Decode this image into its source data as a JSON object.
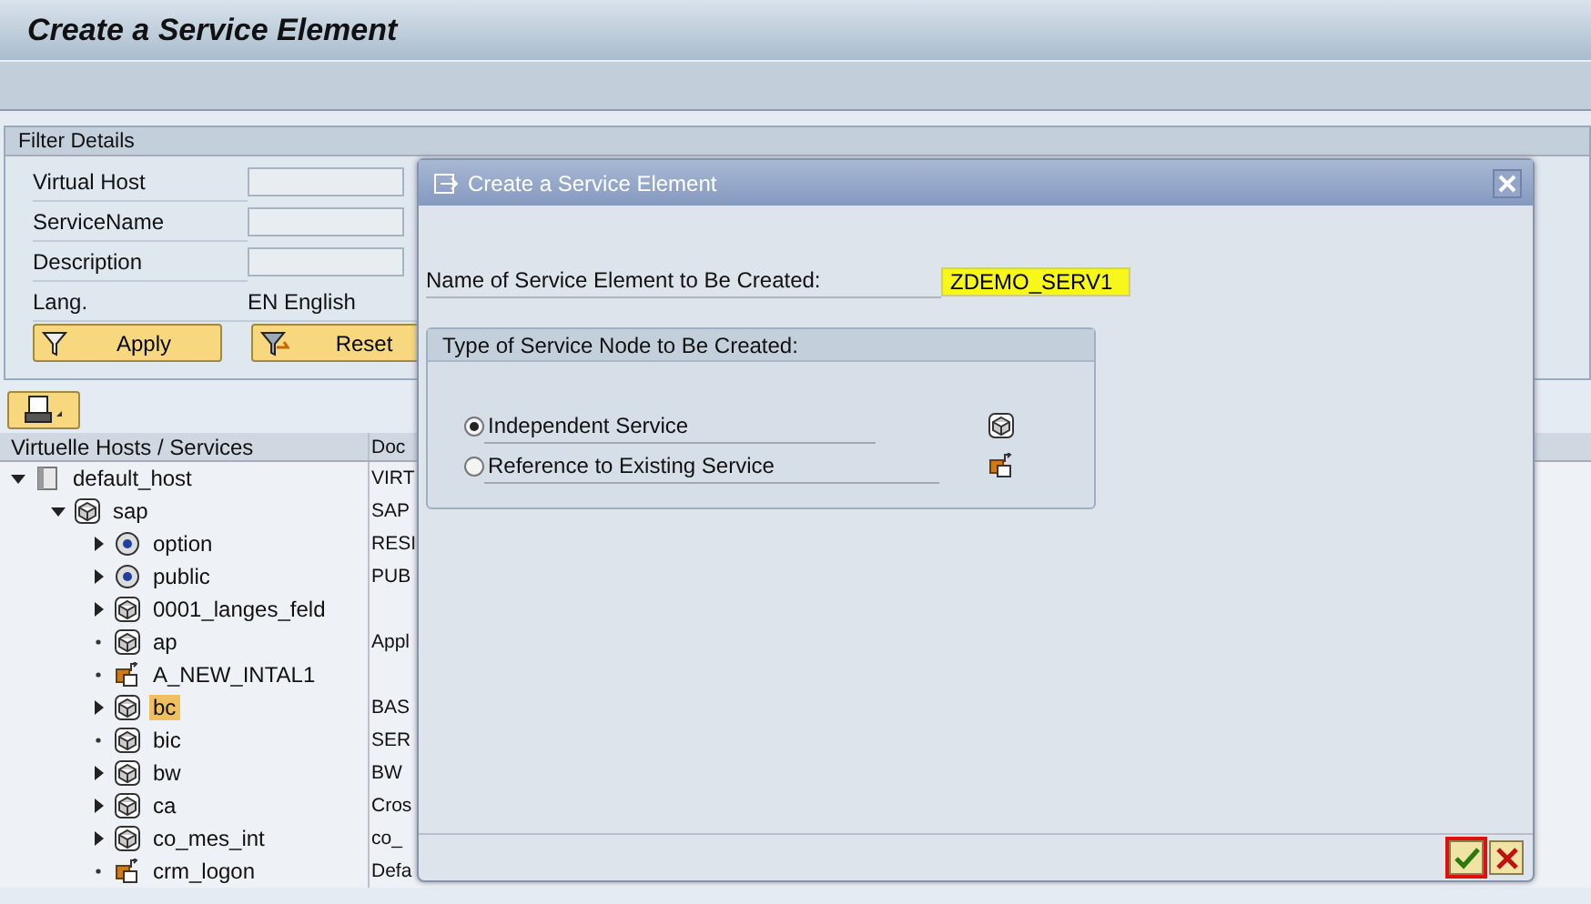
{
  "window": {
    "title": "Create a Service Element"
  },
  "filter": {
    "title": "Filter Details",
    "fields": [
      {
        "label": "Virtual Host"
      },
      {
        "label": "ServiceName"
      },
      {
        "label": "Description"
      },
      {
        "label": "Lang.",
        "value": "EN English"
      }
    ],
    "buttons": [
      "Apply",
      "Reset"
    ]
  },
  "tree": {
    "columns": [
      "Virtuelle Hosts / Services",
      "Doc"
    ],
    "nodes": [
      {
        "name": "default_host",
        "doc": "VIRT",
        "kind": "host",
        "has_children": true,
        "expanded": true,
        "selected": false,
        "children": [
          {
            "name": "sap",
            "doc": "SAP",
            "kind": "service",
            "has_children": true,
            "expanded": true,
            "selected": false,
            "children": [
              {
                "name": "option",
                "doc": "RESI",
                "kind": "node",
                "has_children": true,
                "expanded": false,
                "selected": false
              },
              {
                "name": "public",
                "doc": "PUB",
                "kind": "node",
                "has_children": true,
                "expanded": false,
                "selected": false
              },
              {
                "name": "0001_langes_feld",
                "kind": "service",
                "has_children": true,
                "expanded": false,
                "selected": false
              },
              {
                "name": "ap",
                "doc": "Appl",
                "kind": "service",
                "has_children": false,
                "selected": false
              },
              {
                "name": "A_NEW_INTAL1",
                "kind": "reference",
                "has_children": false,
                "selected": false
              },
              {
                "name": "bc",
                "doc": "BAS",
                "kind": "service",
                "has_children": true,
                "expanded": false,
                "selected": true
              },
              {
                "name": "bic",
                "doc": "SER",
                "kind": "service",
                "has_children": false,
                "selected": false
              },
              {
                "name": "bw",
                "doc": "BW",
                "kind": "service",
                "has_children": true,
                "expanded": false,
                "selected": false
              },
              {
                "name": "ca",
                "doc": "Cros",
                "kind": "service",
                "has_children": true,
                "expanded": false,
                "selected": false
              },
              {
                "name": "co_mes_int",
                "doc": "co_",
                "kind": "service",
                "has_children": true,
                "expanded": false,
                "selected": false
              },
              {
                "name": "crm_logon",
                "doc": "Defa",
                "kind": "reference",
                "has_children": false,
                "selected": false
              }
            ]
          }
        ]
      }
    ]
  },
  "dialog": {
    "title": "Create a Service Element",
    "name_label": "Name of Service Element to Be Created:",
    "name_value": "ZDEMO_SERV1",
    "group_title": "Type of Service Node to Be Created:",
    "options": [
      {
        "label": "Independent Service",
        "kind": "service",
        "selected": true
      },
      {
        "label": "Reference to Existing Service",
        "kind": "reference",
        "selected": false
      }
    ]
  }
}
